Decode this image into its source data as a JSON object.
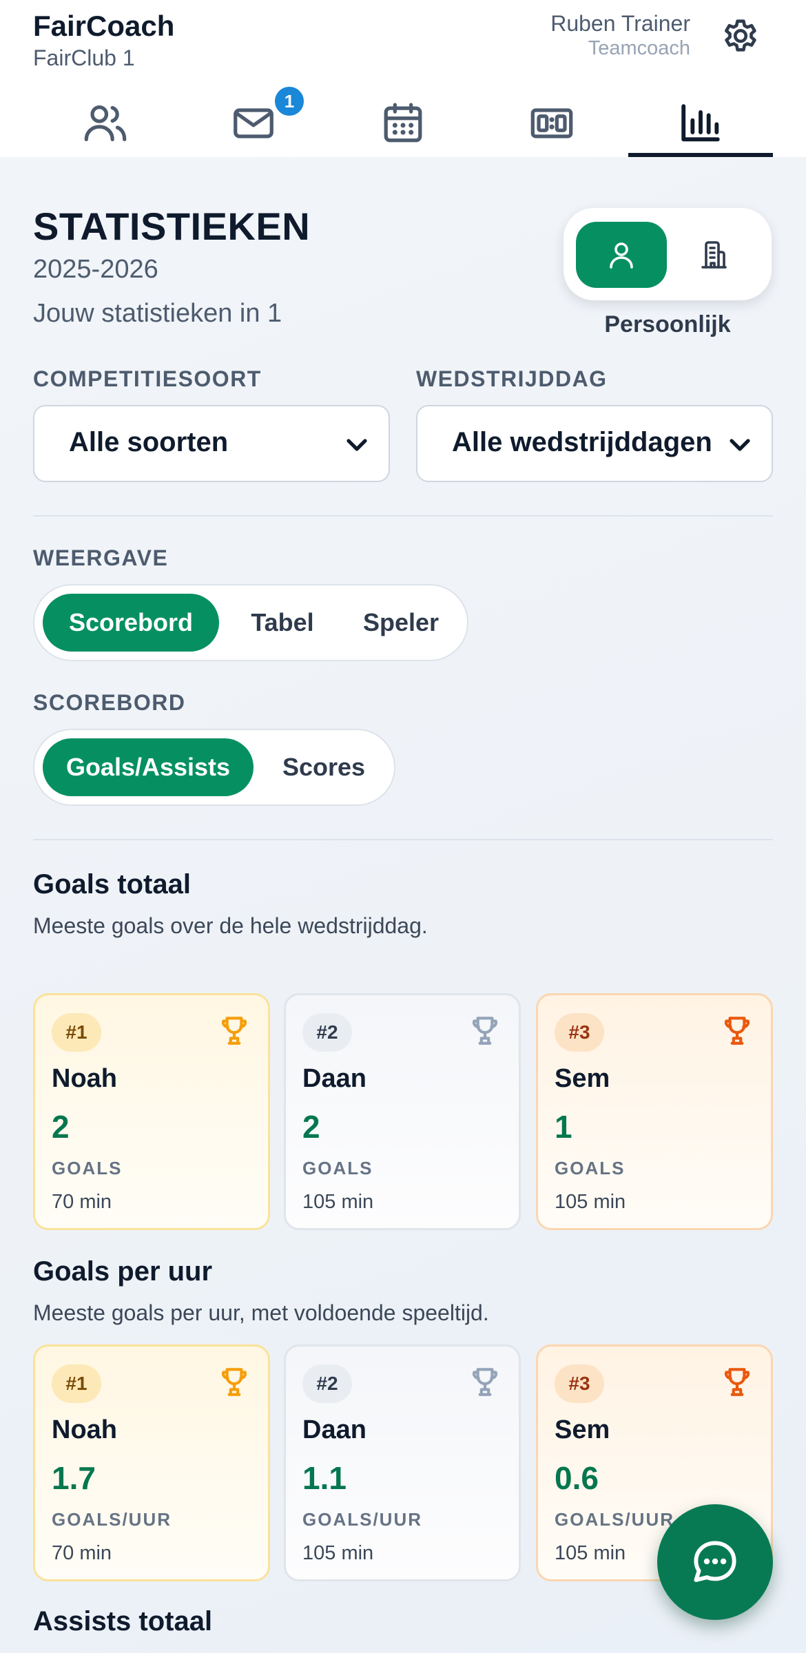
{
  "app": {
    "name": "FairCoach",
    "club": "FairClub 1"
  },
  "user": {
    "name": "Ruben Trainer",
    "role": "Teamcoach"
  },
  "nav": {
    "messages_badge": "1"
  },
  "page": {
    "title": "STATISTIEKEN",
    "season": "2025-2026",
    "subtitle": "Jouw statistieken in 1",
    "scope_label": "Persoonlijk"
  },
  "filters": {
    "competition": {
      "label": "COMPETITIESOORT",
      "value": "Alle soorten"
    },
    "matchday": {
      "label": "WEDSTRIJDDAG",
      "value": "Alle wedstrijddagen"
    }
  },
  "view": {
    "label": "WEERGAVE",
    "options": [
      "Scorebord",
      "Tabel",
      "Speler"
    ],
    "selected": "Scorebord"
  },
  "scoreboard": {
    "label": "SCOREBORD",
    "options": [
      "Goals/Assists",
      "Scores"
    ],
    "selected": "Goals/Assists"
  },
  "sections": [
    {
      "title": "Goals totaal",
      "description": "Meeste goals over de hele wedstrijddag.",
      "cards": [
        {
          "rank": "#1",
          "player": "Noah",
          "value": "2",
          "unit": "GOALS",
          "minutes": "70 min"
        },
        {
          "rank": "#2",
          "player": "Daan",
          "value": "2",
          "unit": "GOALS",
          "minutes": "105 min"
        },
        {
          "rank": "#3",
          "player": "Sem",
          "value": "1",
          "unit": "GOALS",
          "minutes": "105 min"
        }
      ]
    },
    {
      "title": "Goals per uur",
      "description": "Meeste goals per uur, met voldoende speeltijd.",
      "cards": [
        {
          "rank": "#1",
          "player": "Noah",
          "value": "1.7",
          "unit": "GOALS/UUR",
          "minutes": "70 min"
        },
        {
          "rank": "#2",
          "player": "Daan",
          "value": "1.1",
          "unit": "GOALS/UUR",
          "minutes": "105 min"
        },
        {
          "rank": "#3",
          "player": "Sem",
          "value": "0.6",
          "unit": "GOALS/UUR",
          "minutes": "105 min"
        }
      ]
    },
    {
      "title": "Assists totaal"
    }
  ],
  "colors": {
    "accent": "#069061",
    "gold": "#f59e0b",
    "silver": "#94a3b8",
    "bronze": "#ea580c"
  }
}
